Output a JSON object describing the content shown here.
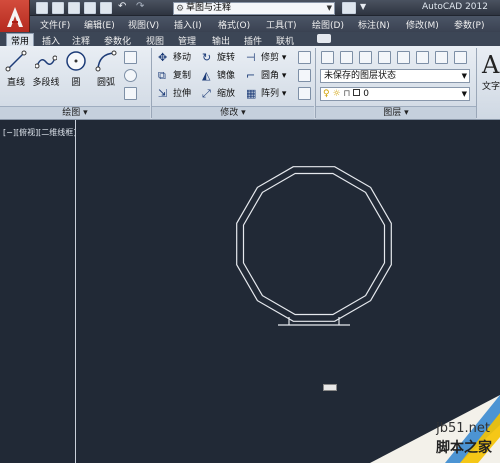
{
  "quick_access": {
    "workspace_value": "草图与注释"
  },
  "title": "AutoCAD 2012",
  "menu": [
    "文件(F)",
    "编辑(E)",
    "视图(V)",
    "插入(I)",
    "格式(O)",
    "工具(T)",
    "绘图(D)",
    "标注(N)",
    "修改(M)",
    "参数(P)"
  ],
  "tabs": [
    "常用",
    "插入",
    "注释",
    "参数化",
    "视图",
    "管理",
    "输出",
    "插件",
    "联机"
  ],
  "draw_panel": {
    "title": "绘图",
    "tools": [
      "直线",
      "多段线",
      "圆",
      "圆弧"
    ]
  },
  "modify_panel": {
    "title": "修改",
    "tools": [
      "移动",
      "旋转",
      "修剪",
      "复制",
      "镜像",
      "圆角",
      "拉伸",
      "缩放",
      "阵列"
    ]
  },
  "layer_panel": {
    "title": "图层",
    "state_value": "未保存的图层状态",
    "layer_value": "0"
  },
  "text_panel": {
    "big_letter": "A",
    "label": "文字"
  },
  "viewport": {
    "label": "[−][俯视][二维线框]"
  },
  "watermark": {
    "site": "jb51.net",
    "name": "脚本之家"
  },
  "colors": {
    "canvas": "#212936",
    "ribbon": "#dfe6ee",
    "accent": "#b62a1c"
  }
}
